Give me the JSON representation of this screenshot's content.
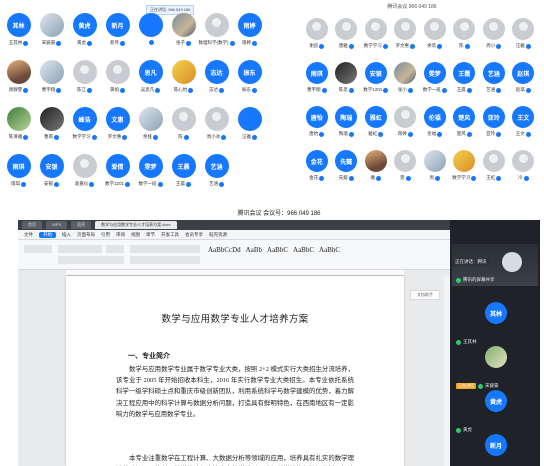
{
  "panel_tl": {
    "tooltip": "正在讲话: 966 049 186",
    "tiles": [
      {
        "avatar": "blue",
        "initials": "其林",
        "name": "王其林"
      },
      {
        "avatar": "photo5",
        "initials": "",
        "name": "宋骏豪"
      },
      {
        "avatar": "blue",
        "initials": "黄虎",
        "name": "黄虎"
      },
      {
        "avatar": "blue",
        "initials": "新月",
        "name": "新月"
      },
      {
        "avatar": "blue",
        "initials": "",
        "name": ""
      },
      {
        "avatar": "photo",
        "initials": "",
        "name": "张子"
      },
      {
        "avatar": "gray",
        "initials": "",
        "name": "数理科学(数学)"
      },
      {
        "avatar": "blue",
        "initials": "雨婷",
        "name": "雨婷"
      },
      {
        "avatar": "photo2",
        "initials": "",
        "name": "周静雯"
      },
      {
        "avatar": "photo5",
        "initials": "",
        "name": "曹宇翔"
      },
      {
        "avatar": "gray",
        "initials": "",
        "name": "陈江"
      },
      {
        "avatar": "gray",
        "initials": "",
        "name": "黄如"
      },
      {
        "avatar": "blue",
        "initials": "思凡",
        "name": "吴思凡"
      },
      {
        "avatar": "photo4",
        "initials": "",
        "name": "陈心怡"
      },
      {
        "avatar": "blue",
        "initials": "志达",
        "name": "志达"
      },
      {
        "avatar": "blue",
        "initials": "振东",
        "name": "振东"
      },
      {
        "avatar": "photo3",
        "initials": "",
        "name": "陈清雅"
      },
      {
        "avatar": "photo6",
        "initials": "",
        "name": "曹雨"
      },
      {
        "avatar": "blue",
        "initials": "峰浩",
        "name": "数学学习"
      },
      {
        "avatar": "blue",
        "initials": "文惠",
        "name": "罗文惠"
      },
      {
        "avatar": "photo5",
        "initials": "",
        "name": "余娅"
      },
      {
        "avatar": "gray",
        "initials": "",
        "name": "陈"
      },
      {
        "avatar": "gray",
        "initials": "",
        "name": "周小冰"
      },
      {
        "avatar": "blue",
        "initials": "",
        "name": "汪雅"
      },
      {
        "avatar": "blue",
        "initials": "雨琪",
        "name": "雨琪"
      },
      {
        "avatar": "blue",
        "initials": "安银",
        "name": "安银"
      },
      {
        "avatar": "gray",
        "initials": "",
        "name": "袁嘉仪"
      },
      {
        "avatar": "blue",
        "initials": "爱倩",
        "name": "数学1201"
      },
      {
        "avatar": "blue",
        "initials": "雯梦",
        "name": "数学一班"
      },
      {
        "avatar": "blue",
        "initials": "王晨",
        "name": "王晨"
      },
      {
        "avatar": "blue",
        "initials": "艺涵",
        "name": "艺涵"
      }
    ]
  },
  "panel_tr": {
    "title": "腾讯会议 966 049 186",
    "tiles": [
      {
        "avatar": "gray",
        "initials": "",
        "name": "谢良"
      },
      {
        "avatar": "gray",
        "initials": "",
        "name": "唐雅"
      },
      {
        "avatar": "gray",
        "initials": "",
        "name": "数学学习"
      },
      {
        "avatar": "gray",
        "initials": "",
        "name": "罗文惠"
      },
      {
        "avatar": "gray",
        "initials": "",
        "name": "余欢"
      },
      {
        "avatar": "gray",
        "initials": "",
        "name": "陈"
      },
      {
        "avatar": "gray",
        "initials": "",
        "name": "周小"
      },
      {
        "avatar": "gray",
        "initials": "",
        "name": "汪雅"
      },
      {
        "avatar": "blue",
        "initials": "雨琪",
        "name": "曹宇翔"
      },
      {
        "avatar": "photo6",
        "initials": "",
        "name": "陈思"
      },
      {
        "avatar": "blue",
        "initials": "安银",
        "name": "数学1201"
      },
      {
        "avatar": "photo",
        "initials": "",
        "name": "张小"
      },
      {
        "avatar": "blue",
        "initials": "雯梦",
        "name": "数学一班"
      },
      {
        "avatar": "blue",
        "initials": "王霞",
        "name": "王晨"
      },
      {
        "avatar": "blue",
        "initials": "艺涵",
        "name": "艺涵"
      },
      {
        "avatar": "blue",
        "initials": "赵琪",
        "name": "赵琪"
      },
      {
        "avatar": "blue",
        "initials": "唐怡",
        "name": "唐怡"
      },
      {
        "avatar": "blue",
        "initials": "陶瑞",
        "name": "陶瑞"
      },
      {
        "avatar": "blue",
        "initials": "雅虹",
        "name": "雅虹"
      },
      {
        "avatar": "gray",
        "initials": "",
        "name": "蒋婷"
      },
      {
        "avatar": "blue",
        "initials": "伦福",
        "name": "伦福"
      },
      {
        "avatar": "blue",
        "initials": "楚风",
        "name": "楚风"
      },
      {
        "avatar": "blue",
        "initials": "亚玲",
        "name": "亚玲"
      },
      {
        "avatar": "blue",
        "initials": "王文",
        "name": "王文"
      },
      {
        "avatar": "blue",
        "initials": "金花",
        "name": "金花"
      },
      {
        "avatar": "blue",
        "initials": "先懿",
        "name": "先懿"
      },
      {
        "avatar": "photo2",
        "initials": "",
        "name": "雅"
      },
      {
        "avatar": "gray",
        "initials": "",
        "name": "景"
      },
      {
        "avatar": "photo5",
        "initials": "",
        "name": "周"
      },
      {
        "avatar": "photo4",
        "initials": "",
        "name": "数学学习"
      },
      {
        "avatar": "gray",
        "initials": "",
        "name": "王虹"
      },
      {
        "avatar": "gray",
        "initials": "",
        "name": "冷"
      }
    ]
  },
  "share": {
    "window_title": "腾讯会议 会议号：966 049 186",
    "tabs": [
      "首页",
      "WPS",
      "稻壳",
      "数学与应用数学专业人才培养方案.docx"
    ],
    "menus": [
      "文件",
      "开始",
      "插入",
      "页面布局",
      "引用",
      "审阅",
      "视图",
      "章节",
      "开发工具",
      "会员专享",
      "稻壳资源"
    ],
    "style_samples": [
      "AaBbCcDd",
      "AaBb",
      "AaBbC",
      "AaBbC",
      "AaBbC"
    ],
    "side_button": "文档助手",
    "document": {
      "title": "数学与应用数学专业人才培养方案",
      "heading": "一、专业简介",
      "para1": "数学与应用数学专业属于数学专业大类，按照 2+2 模式实行大类招生分流培养，该专业于 2005 年开始招收本科生，2016 年实行数学专业大类招生。本专业依托系统科学一级学科硕士点和重庆市级创新团队，利用系统科学与数学建模的优势，着力解决工程应用中的科学计算与数据分析问题，打造具有鲜明特色，在西南地区有一定影响力的数学与应用数学专业。",
      "para2": "本专业注重数学在工程计算、大数据分析等领域的应用，培养具有扎实的数学理论基础知识，能利用数学推论与方法建立数学模型，进行科学计算与数据分析，解决实际问题"
    }
  },
  "column": {
    "speaker_label": "正在讲话：腾讯",
    "cam_user": "腾讯的屏幕共享",
    "tiles": [
      {
        "initials": "其林",
        "name": "王其林",
        "photo": false,
        "speaking": false
      },
      {
        "initials": "",
        "name": "宋骏豪",
        "photo": true,
        "speaking": true
      },
      {
        "initials": "黄虎",
        "name": "黄虎",
        "photo": false,
        "speaking": false
      },
      {
        "initials": "新月",
        "name": "",
        "photo": false,
        "speaking": false
      }
    ],
    "speaking_tag": "正在讲话"
  }
}
